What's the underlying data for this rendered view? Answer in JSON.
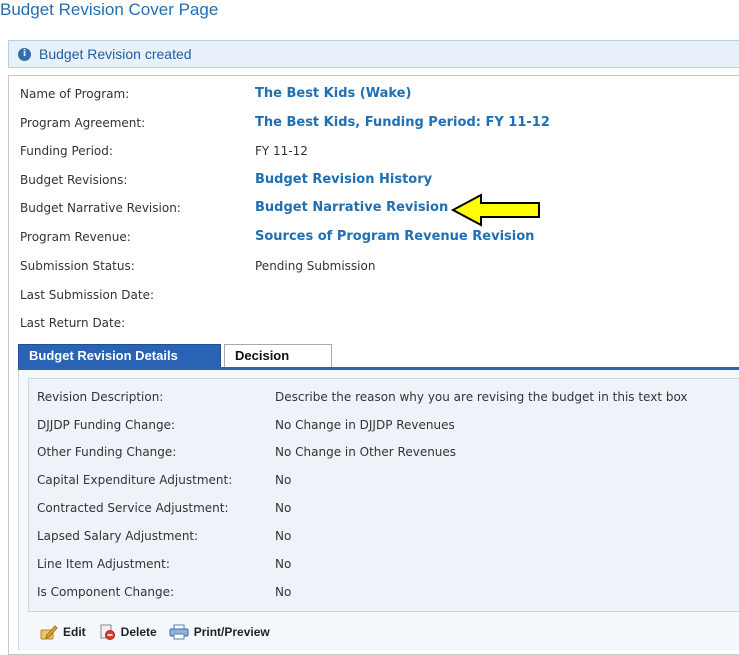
{
  "page": {
    "title": "Budget Revision Cover Page"
  },
  "message": {
    "icon": "info-icon",
    "text": "Budget Revision created"
  },
  "program_info": [
    {
      "label": "Name of Program:",
      "value": "The Best Kids (Wake)",
      "is_link": true
    },
    {
      "label": "Program Agreement:",
      "value": "The Best Kids, Funding Period: FY 11-12",
      "is_link": true
    },
    {
      "label": "Funding Period:",
      "value": "FY 11-12",
      "is_link": false
    },
    {
      "label": "Budget Revisions:",
      "value": "Budget Revision History",
      "is_link": true
    },
    {
      "label": "Budget Narrative Revision:",
      "value": "Budget Narrative Revision",
      "is_link": true
    },
    {
      "label": "Program Revenue:",
      "value": "Sources of Program Revenue Revision",
      "is_link": true
    },
    {
      "label": "Submission Status:",
      "value": "Pending Submission",
      "is_link": false
    },
    {
      "label": "Last Submission Date:",
      "value": "",
      "is_link": false
    },
    {
      "label": "Last Return Date:",
      "value": "",
      "is_link": false
    }
  ],
  "tabs": [
    {
      "label": "Budget Revision Details",
      "active": true
    },
    {
      "label": "Decision",
      "active": false
    }
  ],
  "details": [
    {
      "label": "Revision Description:",
      "value": "Describe the reason why you are revising the budget in this text box"
    },
    {
      "label": "DJJDP Funding Change:",
      "value": "No Change in DJJDP Revenues"
    },
    {
      "label": "Other Funding Change:",
      "value": "No Change in Other Revenues"
    },
    {
      "label": "Capital Expenditure Adjustment:",
      "value": "No"
    },
    {
      "label": "Contracted Service Adjustment:",
      "value": "No"
    },
    {
      "label": "Lapsed Salary Adjustment:",
      "value": "No"
    },
    {
      "label": "Line Item Adjustment:",
      "value": "No"
    },
    {
      "label": "Is Component Change:",
      "value": "No"
    }
  ],
  "toolbar": {
    "edit_label": "Edit",
    "delete_label": "Delete",
    "print_label": "Print/Preview"
  },
  "colors": {
    "link": "#1f6fb2",
    "tab_active": "#2a63b4",
    "arrow_fill": "#ffff00"
  }
}
